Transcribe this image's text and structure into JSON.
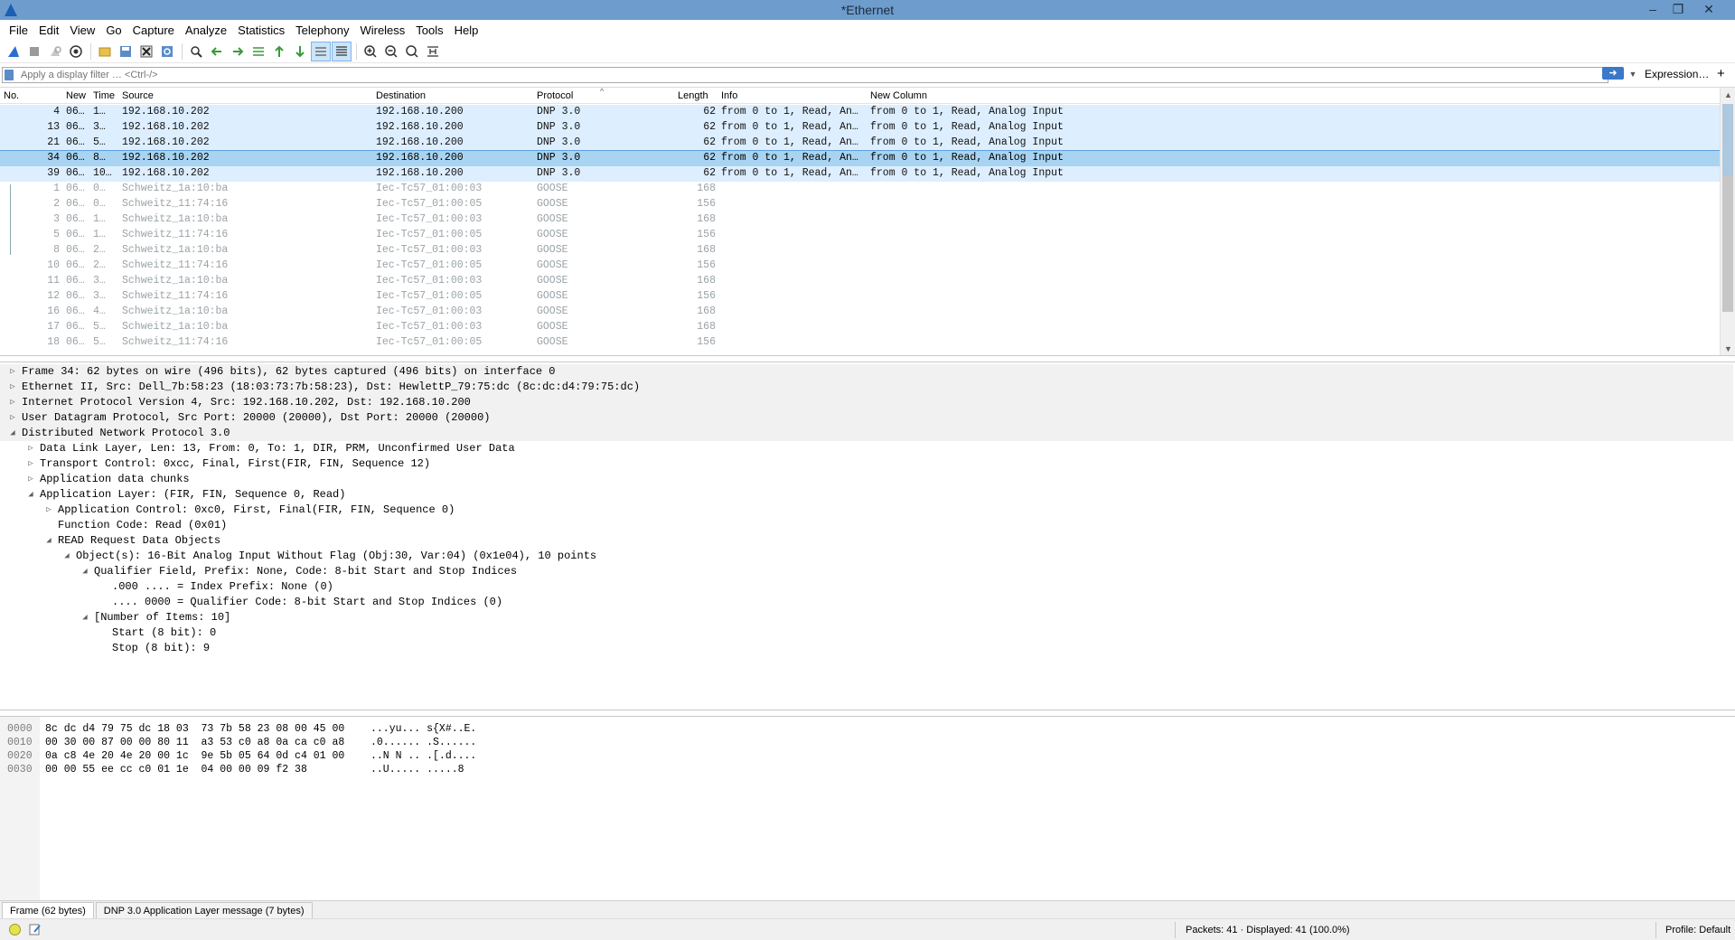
{
  "window": {
    "title": "*Ethernet",
    "buttons": {
      "minimize": "–",
      "restore": "❐",
      "close": "✕"
    }
  },
  "menu": [
    "File",
    "Edit",
    "View",
    "Go",
    "Capture",
    "Analyze",
    "Statistics",
    "Telephony",
    "Wireless",
    "Tools",
    "Help"
  ],
  "toolbar": {
    "icons": [
      "shark-fin-start-icon",
      "stop-icon",
      "restart-icon",
      "capture-options-icon",
      "open-file-icon",
      "save-file-icon",
      "close-file-icon",
      "reload-icon",
      "find-packet-icon",
      "go-back-icon",
      "go-forward-icon",
      "go-to-packet-icon",
      "go-first-icon",
      "go-last-icon",
      "autoscroll-icon",
      "colorize-icon",
      "zoom-in-icon",
      "zoom-out-icon",
      "zoom-normal-icon",
      "resize-columns-icon"
    ]
  },
  "filter": {
    "placeholder": "Apply a display filter … <Ctrl-/>",
    "expression_label": "Expression…",
    "add_label": "+"
  },
  "packet_list": {
    "columns": [
      "No.",
      "New",
      "Time",
      "Source",
      "Destination",
      "Protocol",
      "Length",
      "Info",
      "New Column"
    ],
    "rows": [
      {
        "no": "4",
        "new": "06…",
        "time": "1…",
        "source": "192.168.10.202",
        "destination": "192.168.10.200",
        "protocol": "DNP 3.0",
        "length": "62",
        "info": "from 0 to 1, Read, An…",
        "newcol": "from 0 to 1, Read, Analog Input",
        "kind": "dnp"
      },
      {
        "no": "13",
        "new": "06…",
        "time": "3…",
        "source": "192.168.10.202",
        "destination": "192.168.10.200",
        "protocol": "DNP 3.0",
        "length": "62",
        "info": "from 0 to 1, Read, An…",
        "newcol": "from 0 to 1, Read, Analog Input",
        "kind": "dnp"
      },
      {
        "no": "21",
        "new": "06…",
        "time": "5…",
        "source": "192.168.10.202",
        "destination": "192.168.10.200",
        "protocol": "DNP 3.0",
        "length": "62",
        "info": "from 0 to 1, Read, An…",
        "newcol": "from 0 to 1, Read, Analog Input",
        "kind": "dnp"
      },
      {
        "no": "34",
        "new": "06…",
        "time": "8…",
        "source": "192.168.10.202",
        "destination": "192.168.10.200",
        "protocol": "DNP 3.0",
        "length": "62",
        "info": "from 0 to 1, Read, An…",
        "newcol": "from 0 to 1, Read, Analog Input",
        "kind": "selected"
      },
      {
        "no": "39",
        "new": "06…",
        "time": "10…",
        "source": "192.168.10.202",
        "destination": "192.168.10.200",
        "protocol": "DNP 3.0",
        "length": "62",
        "info": "from 0 to 1, Read, An…",
        "newcol": "from 0 to 1, Read, Analog Input",
        "kind": "dnp"
      },
      {
        "no": "1",
        "new": "06…",
        "time": "0…",
        "source": "Schweitz_1a:10:ba",
        "destination": "Iec-Tc57_01:00:03",
        "protocol": "GOOSE",
        "length": "168",
        "info": "",
        "newcol": "",
        "kind": "goose"
      },
      {
        "no": "2",
        "new": "06…",
        "time": "0…",
        "source": "Schweitz_11:74:16",
        "destination": "Iec-Tc57_01:00:05",
        "protocol": "GOOSE",
        "length": "156",
        "info": "",
        "newcol": "",
        "kind": "goose"
      },
      {
        "no": "3",
        "new": "06…",
        "time": "1…",
        "source": "Schweitz_1a:10:ba",
        "destination": "Iec-Tc57_01:00:03",
        "protocol": "GOOSE",
        "length": "168",
        "info": "",
        "newcol": "",
        "kind": "goose"
      },
      {
        "no": "5",
        "new": "06…",
        "time": "1…",
        "source": "Schweitz_11:74:16",
        "destination": "Iec-Tc57_01:00:05",
        "protocol": "GOOSE",
        "length": "156",
        "info": "",
        "newcol": "",
        "kind": "goose"
      },
      {
        "no": "8",
        "new": "06…",
        "time": "2…",
        "source": "Schweitz_1a:10:ba",
        "destination": "Iec-Tc57_01:00:03",
        "protocol": "GOOSE",
        "length": "168",
        "info": "",
        "newcol": "",
        "kind": "goose"
      },
      {
        "no": "10",
        "new": "06…",
        "time": "2…",
        "source": "Schweitz_11:74:16",
        "destination": "Iec-Tc57_01:00:05",
        "protocol": "GOOSE",
        "length": "156",
        "info": "",
        "newcol": "",
        "kind": "goose"
      },
      {
        "no": "11",
        "new": "06…",
        "time": "3…",
        "source": "Schweitz_1a:10:ba",
        "destination": "Iec-Tc57_01:00:03",
        "protocol": "GOOSE",
        "length": "168",
        "info": "",
        "newcol": "",
        "kind": "goose"
      },
      {
        "no": "12",
        "new": "06…",
        "time": "3…",
        "source": "Schweitz_11:74:16",
        "destination": "Iec-Tc57_01:00:05",
        "protocol": "GOOSE",
        "length": "156",
        "info": "",
        "newcol": "",
        "kind": "goose"
      },
      {
        "no": "16",
        "new": "06…",
        "time": "4…",
        "source": "Schweitz_1a:10:ba",
        "destination": "Iec-Tc57_01:00:03",
        "protocol": "GOOSE",
        "length": "168",
        "info": "",
        "newcol": "",
        "kind": "goose"
      },
      {
        "no": "17",
        "new": "06…",
        "time": "5…",
        "source": "Schweitz_1a:10:ba",
        "destination": "Iec-Tc57_01:00:03",
        "protocol": "GOOSE",
        "length": "168",
        "info": "",
        "newcol": "",
        "kind": "goose"
      },
      {
        "no": "18",
        "new": "06…",
        "time": "5…",
        "source": "Schweitz_11:74:16",
        "destination": "Iec-Tc57_01:00:05",
        "protocol": "GOOSE",
        "length": "156",
        "info": "",
        "newcol": "",
        "kind": "goose"
      }
    ]
  },
  "details": [
    {
      "level": 0,
      "toggle": "collapsed",
      "text": "Frame 34: 62 bytes on wire (496 bits), 62 bytes captured (496 bits) on interface 0"
    },
    {
      "level": 0,
      "toggle": "collapsed",
      "text": "Ethernet II, Src: Dell_7b:58:23 (18:03:73:7b:58:23), Dst: HewlettP_79:75:dc (8c:dc:d4:79:75:dc)"
    },
    {
      "level": 0,
      "toggle": "collapsed",
      "text": "Internet Protocol Version 4, Src: 192.168.10.202, Dst: 192.168.10.200"
    },
    {
      "level": 0,
      "toggle": "collapsed",
      "text": "User Datagram Protocol, Src Port: 20000 (20000), Dst Port: 20000 (20000)"
    },
    {
      "level": 0,
      "toggle": "expanded",
      "text": "Distributed Network Protocol 3.0"
    },
    {
      "level": 1,
      "toggle": "collapsed",
      "text": "Data Link Layer, Len: 13, From: 0, To: 1, DIR, PRM, Unconfirmed User Data"
    },
    {
      "level": 1,
      "toggle": "collapsed",
      "text": "Transport Control: 0xcc, Final, First(FIR, FIN, Sequence 12)"
    },
    {
      "level": 1,
      "toggle": "collapsed",
      "text": "Application data chunks"
    },
    {
      "level": 1,
      "toggle": "expanded",
      "text": "Application Layer: (FIR, FIN, Sequence 0, Read)"
    },
    {
      "level": 2,
      "toggle": "collapsed",
      "text": "Application Control: 0xc0, First, Final(FIR, FIN, Sequence 0)"
    },
    {
      "level": 2,
      "toggle": "none",
      "text": "Function Code: Read (0x01)"
    },
    {
      "level": 2,
      "toggle": "expanded",
      "text": "READ Request Data Objects"
    },
    {
      "level": 3,
      "toggle": "expanded",
      "text": "Object(s): 16-Bit Analog Input Without Flag (Obj:30, Var:04) (0x1e04), 10 points"
    },
    {
      "level": 4,
      "toggle": "expanded",
      "text": "Qualifier Field, Prefix: None, Code: 8-bit Start and Stop Indices"
    },
    {
      "level": 5,
      "toggle": "none",
      "text": ".000 .... = Index Prefix: None (0)"
    },
    {
      "level": 5,
      "toggle": "none",
      "text": ".... 0000 = Qualifier Code: 8-bit Start and Stop Indices (0)"
    },
    {
      "level": 4,
      "toggle": "expanded",
      "text": "[Number of Items: 10]"
    },
    {
      "level": 5,
      "toggle": "none",
      "text": "Start (8 bit): 0"
    },
    {
      "level": 5,
      "toggle": "none",
      "text": "Stop (8 bit): 9"
    }
  ],
  "bytes": [
    {
      "offset": "0000",
      "hex": "8c dc d4 79 75 dc 18 03  73 7b 58 23 08 00 45 00",
      "ascii": "...yu... s{X#..E."
    },
    {
      "offset": "0010",
      "hex": "00 30 00 87 00 00 80 11  a3 53 c0 a8 0a ca c0 a8",
      "ascii": ".0...... .S......"
    },
    {
      "offset": "0020",
      "hex": "0a c8 4e 20 4e 20 00 1c  9e 5b 05 64 0d c4 01 00",
      "ascii": "..N N .. .[.d...."
    },
    {
      "offset": "0030",
      "hex": "00 00 55 ee cc c0 01 1e  04 00 00 09 f2 38",
      "ascii": "..U..... .....8"
    }
  ],
  "bottom_tabs": [
    "Frame (62 bytes)",
    "DNP 3.0 Application Layer message (7 bytes)"
  ],
  "status": {
    "packets": "Packets: 41 · Displayed: 41 (100.0%)",
    "profile": "Profile: Default"
  }
}
